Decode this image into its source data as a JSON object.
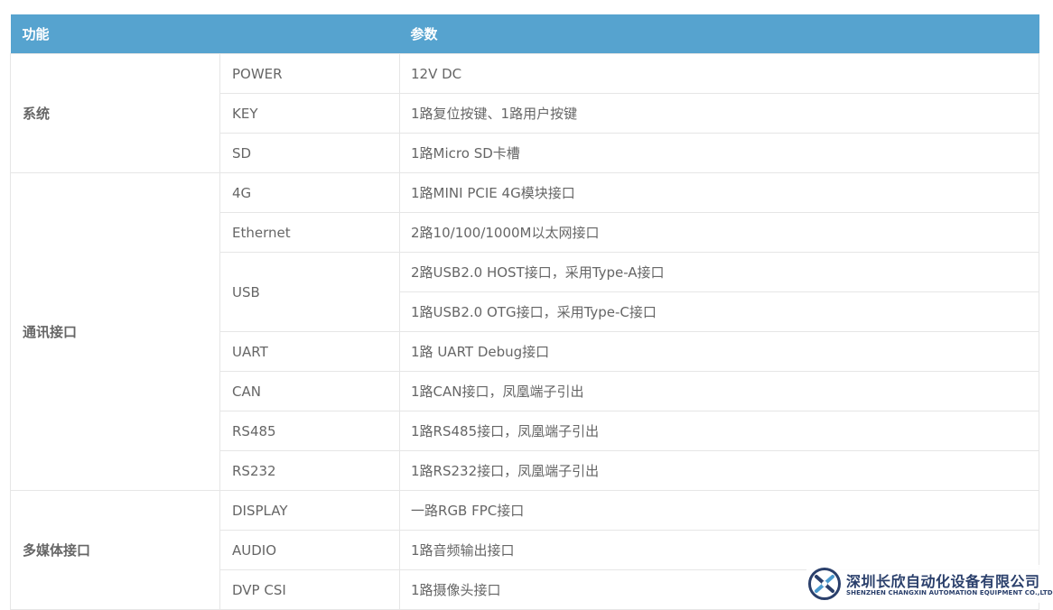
{
  "header": {
    "function_label": "功能",
    "param_label": "参数"
  },
  "groups": [
    {
      "name": "系统",
      "rows": [
        {
          "item": "POWER",
          "values": [
            "12V DC"
          ]
        },
        {
          "item": "KEY",
          "values": [
            "1路复位按键、1路用户按键"
          ]
        },
        {
          "item": "SD",
          "values": [
            "1路Micro SD卡槽"
          ]
        }
      ]
    },
    {
      "name": "通讯接口",
      "rows": [
        {
          "item": "4G",
          "values": [
            "1路MINI PCIE 4G模块接口"
          ]
        },
        {
          "item": "Ethernet",
          "values": [
            "2路10/100/1000M以太网接口"
          ]
        },
        {
          "item": "USB",
          "values": [
            "2路USB2.0 HOST接口，采用Type-A接口",
            "1路USB2.0 OTG接口，采用Type-C接口"
          ]
        },
        {
          "item": "UART",
          "values": [
            "1路 UART Debug接口"
          ]
        },
        {
          "item": "CAN",
          "values": [
            "1路CAN接口，凤凰端子引出"
          ]
        },
        {
          "item": "RS485",
          "values": [
            "1路RS485接口，凤凰端子引出"
          ]
        },
        {
          "item": "RS232",
          "values": [
            "1路RS232接口，凤凰端子引出"
          ]
        }
      ]
    },
    {
      "name": "多媒体接口",
      "rows": [
        {
          "item": "DISPLAY",
          "values": [
            "一路RGB FPC接口"
          ]
        },
        {
          "item": "AUDIO",
          "values": [
            "1路音频输出接口"
          ]
        },
        {
          "item": "DVP CSI",
          "values": [
            "1路摄像头接口"
          ]
        }
      ]
    }
  ],
  "logo": {
    "name_cn": "深圳长欣自动化设备有限公司",
    "name_en": "SHENZHEN CHANGXIN AUTOMATION EQUIPMENT CO.,LTD"
  },
  "colors": {
    "header_bg": "#56a3cf",
    "header_text": "#ffffff",
    "border": "#e6e6e6",
    "text": "#666666",
    "logo": "#2a3f6b"
  }
}
